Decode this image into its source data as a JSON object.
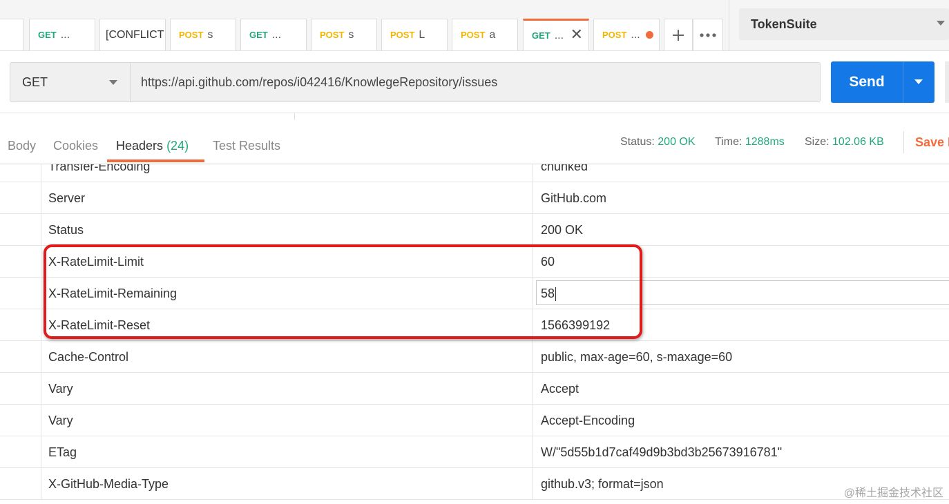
{
  "tabs": [
    {
      "method": "",
      "name": "",
      "method_color": ""
    },
    {
      "method": "GET",
      "name": "...",
      "method_color": "#21a87a"
    },
    {
      "method": "",
      "name": "[CONFLICT",
      "method_color": ""
    },
    {
      "method": "POST",
      "name": "s",
      "method_color": "#f3b500"
    },
    {
      "method": "GET",
      "name": "...",
      "method_color": "#21a87a"
    },
    {
      "method": "POST",
      "name": "s",
      "method_color": "#f3b500"
    },
    {
      "method": "POST",
      "name": "L",
      "method_color": "#f3b500"
    },
    {
      "method": "POST",
      "name": "a",
      "method_color": "#f3b500"
    },
    {
      "method": "GET",
      "name": "...",
      "method_color": "#21a87a"
    },
    {
      "method": "POST",
      "name": "...",
      "method_color": "#f3b500"
    }
  ],
  "new_tab_icon": "plus-icon",
  "more_tabs_icon": "ellipsis-icon",
  "environment": "TokenSuite",
  "request": {
    "method": "GET",
    "url": "https://api.github.com/repos/i042416/KnowlegeRepository/issues",
    "send_label": "Send"
  },
  "response_tabs": {
    "body": "Body",
    "cookies": "Cookies",
    "headers": "Headers",
    "headers_count": "(24)",
    "test_results": "Test Results"
  },
  "status": {
    "label": "Status:",
    "value": "200 OK"
  },
  "time": {
    "label": "Time:",
    "value": "1288ms"
  },
  "size": {
    "label": "Size:",
    "value": "102.06 KB"
  },
  "save_response_label": "Save R",
  "headers": [
    {
      "key": "Transfer-Encoding",
      "value": "chunked"
    },
    {
      "key": "Server",
      "value": "GitHub.com"
    },
    {
      "key": "Status",
      "value": "200 OK"
    },
    {
      "key": "X-RateLimit-Limit",
      "value": "60"
    },
    {
      "key": "X-RateLimit-Remaining",
      "value": "58"
    },
    {
      "key": "X-RateLimit-Reset",
      "value": "1566399192"
    },
    {
      "key": "Cache-Control",
      "value": "public, max-age=60, s-maxage=60"
    },
    {
      "key": "Vary",
      "value": "Accept"
    },
    {
      "key": "Vary",
      "value": "Accept-Encoding"
    },
    {
      "key": "ETag",
      "value": "W/\"5d55b1d7caf49d9b3bd3b25673916781\""
    },
    {
      "key": "X-GitHub-Media-Type",
      "value": "github.v3; format=json"
    }
  ],
  "editing_row": 4,
  "watermark": "@稀土掘金技术社区",
  "colors": {
    "accent": "#f26b3a",
    "send": "#1478e6",
    "ok": "#21a87a",
    "post": "#f3b500",
    "highlight": "#e01b1b"
  }
}
